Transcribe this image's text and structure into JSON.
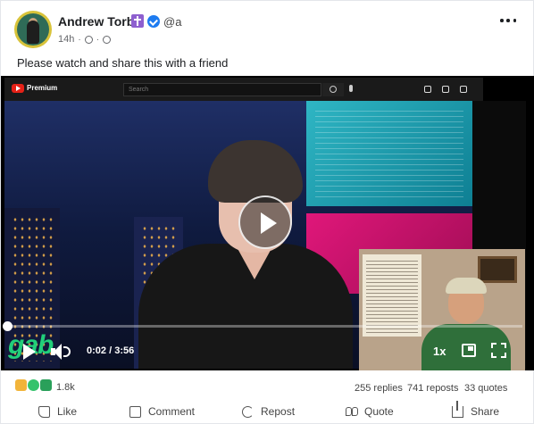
{
  "post": {
    "author_name": "Andrew Torba",
    "handle": "@a",
    "time_ago": "14h",
    "meta_separator": "·",
    "text": "Please watch and share this with a friend"
  },
  "video": {
    "youtube_brand": "Premium",
    "search_placeholder": "Search",
    "overlay_logo": "gab",
    "current_time": "0:02",
    "time_separator": "/",
    "duration": "3:56",
    "progress_fraction": 0.008,
    "speed": "1x"
  },
  "stats": {
    "reaction_count": "1.8k",
    "replies": "255 replies",
    "reposts": "741 reposts",
    "quotes": "33 quotes"
  },
  "actions": {
    "like": "Like",
    "comment": "Comment",
    "repost": "Repost",
    "quote": "Quote",
    "share": "Share"
  },
  "icons": {
    "avatar": "avatar",
    "badge_1": "cross-badge-icon",
    "badge_2": "verified-check-icon",
    "more": "more-options-icon"
  },
  "colors": {
    "gab_green": "#21cf7a",
    "verified_blue": "#1d7bf0",
    "cross_badge": "#8e5fcf"
  }
}
